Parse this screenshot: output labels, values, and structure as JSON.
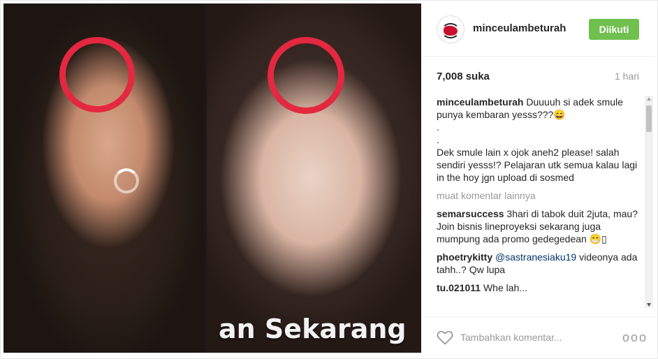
{
  "post": {
    "caption_overlay": "an Sekarang"
  },
  "header": {
    "username": "minceulambeturah",
    "follow_label": "Diikuti"
  },
  "stats": {
    "likes": "7,008 suka",
    "time": "1 hari"
  },
  "comments": {
    "caption": {
      "user": "minceulambeturah",
      "lines": [
        "Duuuuh si adek smule punya kembaran yesss???😄",
        ".",
        ".",
        "Dek smule lain x ojok aneh2 please! salah sendiri yesss!? Pelajaran utk semua kalau lagi in the hoy jgn upload di sosmed"
      ]
    },
    "load_more": "muat komentar lainnya",
    "items": [
      {
        "user": "semarsuccess",
        "text": "3hari di tabok duit 2juta, mau? Join bisnis lineproyeksi sekarang juga mumpung ada promo gedegedean 😁▯"
      },
      {
        "user": "phoetrykitty",
        "mention": "@sastranesiaku19",
        "text": " videonya ada tahh..? Qw lupa"
      },
      {
        "user": "tu.021011",
        "text": "Whe lah..."
      }
    ]
  },
  "footer": {
    "placeholder": "Tambahkan komentar...",
    "more_label": "ooo"
  },
  "colors": {
    "follow_button": "#70c050",
    "ring": "#e3283f",
    "mention": "#003569"
  },
  "icons": {
    "heart": "heart-outline-icon",
    "more": "more-options-icon",
    "loading": "loading-spinner-icon"
  }
}
